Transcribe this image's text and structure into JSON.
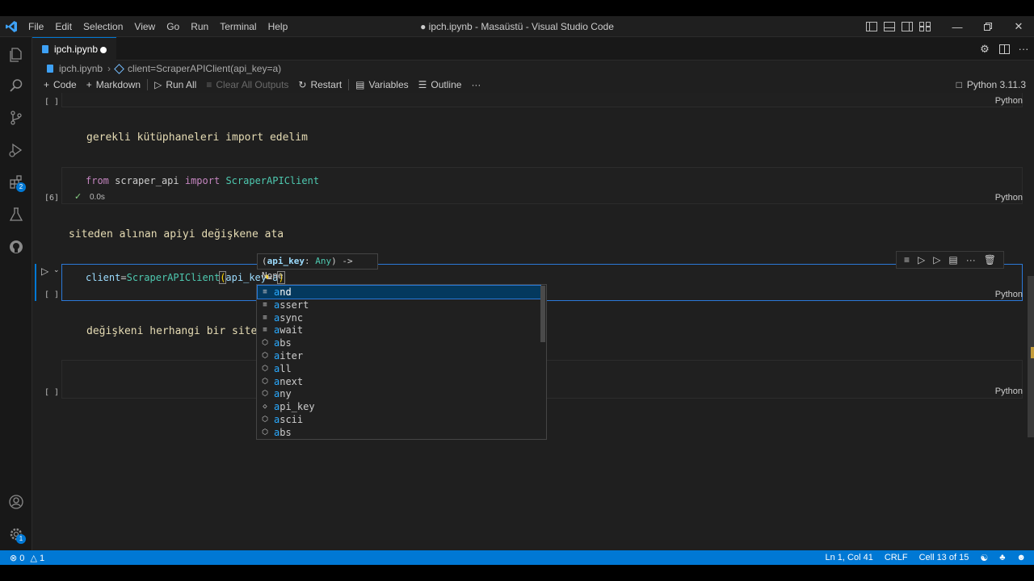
{
  "window": {
    "title": "● ipch.ipynb - Masaüstü - Visual Studio Code",
    "menu": [
      "File",
      "Edit",
      "Selection",
      "View",
      "Go",
      "Run",
      "Terminal",
      "Help"
    ]
  },
  "activity_bar": {
    "items": [
      "explorer-icon",
      "search-icon",
      "source-control-icon",
      "run-debug-icon",
      "extensions-icon",
      "testing-icon",
      "github-icon"
    ],
    "extensions_badge": "2",
    "settings_badge": "1",
    "bottom": [
      "account-icon",
      "manage-icon"
    ]
  },
  "tab": {
    "label": "ipch.ipynb"
  },
  "breadcrumb": {
    "file": "ipch.ipynb",
    "symbol": "client=ScraperAPIClient(api_key=a)"
  },
  "toolbar": {
    "code": "Code",
    "markdown": "Markdown",
    "run_all": "Run All",
    "clear_outputs": "Clear All Outputs",
    "restart": "Restart",
    "variables": "Variables",
    "outline": "Outline",
    "more": "···",
    "kernel": "Python 3.11.3"
  },
  "cells": {
    "c1_exec": "[ ]",
    "c1_lang": "Python",
    "md1": "gerekli kütüphaneleri import edelim",
    "c2_code": {
      "kw1": "from",
      "mod": "scraper_api",
      "kw2": "import",
      "cls": "ScraperAPIClient"
    },
    "c2_exec": "[6]",
    "c2_time": "0.0s",
    "c2_lang": "Python",
    "md2": "siteden alınan apiyi değişkene ata",
    "c3_code": {
      "var": "client",
      "eq": "=",
      "cls": "ScraperAPIClient",
      "open": "(",
      "param": "api_key",
      "eq2": "=",
      "val": "a",
      "close": ")"
    },
    "c3_exec": "[ ]",
    "c3_lang": "Python",
    "md3": "değişkeni herhangi bir sitey",
    "c4_exec": "[ ]",
    "c4_lang": "Python"
  },
  "param_hint": {
    "open": "(",
    "name": "api_key",
    "colon": ":",
    "type": "Any",
    "close": ")",
    "ret": " -> None"
  },
  "suggestions": [
    {
      "label": "and",
      "kind": "keyword"
    },
    {
      "label": "assert",
      "kind": "keyword"
    },
    {
      "label": "async",
      "kind": "keyword"
    },
    {
      "label": "await",
      "kind": "keyword"
    },
    {
      "label": "abs",
      "kind": "function"
    },
    {
      "label": "aiter",
      "kind": "function"
    },
    {
      "label": "all",
      "kind": "function"
    },
    {
      "label": "anext",
      "kind": "function"
    },
    {
      "label": "any",
      "kind": "function"
    },
    {
      "label": "api_key",
      "kind": "variable"
    },
    {
      "label": "ascii",
      "kind": "function"
    },
    {
      "label": "abs",
      "kind": "function"
    }
  ],
  "status": {
    "errors": "0",
    "warnings": "1",
    "position": "Ln 1, Col 41",
    "eol": "CRLF",
    "cell": "Cell 13 of 15"
  },
  "colors": {
    "accent": "#0078d4",
    "keyword": "#c586c0",
    "class": "#4ec9b0",
    "markdown": "#e6dcb4"
  }
}
